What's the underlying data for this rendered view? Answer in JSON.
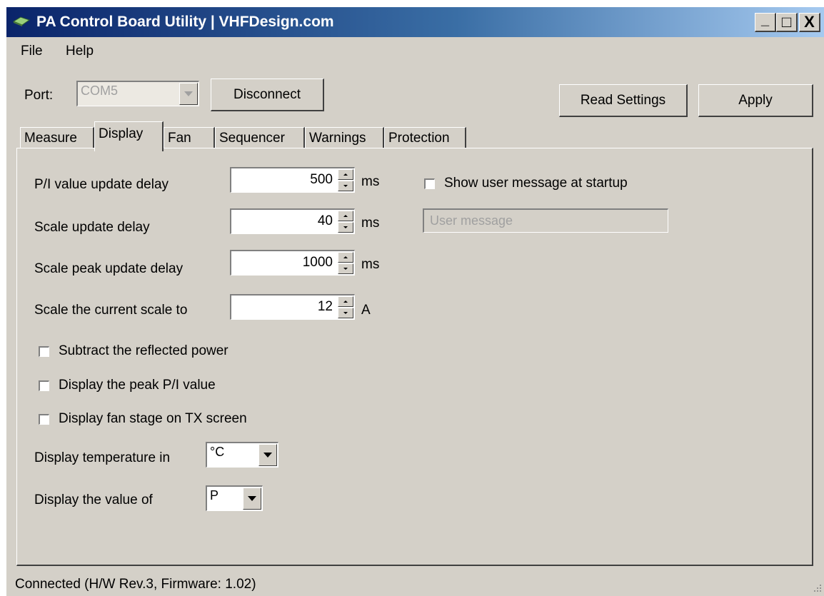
{
  "window": {
    "title": "PA Control Board Utility | VHFDesign.com",
    "minimize_label": "_",
    "maximize_label": "□",
    "close_label": "X"
  },
  "menu": [
    "File",
    "Help"
  ],
  "toolbar": {
    "port_label": "Port:",
    "port_value": "COM5",
    "disconnect_label": "Disconnect",
    "read_settings_label": "Read Settings",
    "apply_label": "Apply"
  },
  "tabs": [
    "Measure",
    "Display",
    "Fan",
    "Sequencer",
    "Warnings",
    "Protection"
  ],
  "active_tab": "Display",
  "display": {
    "rows": [
      {
        "label": "P/I value update delay",
        "value": "500",
        "unit": "ms"
      },
      {
        "label": "Scale update delay",
        "value": "40",
        "unit": "ms"
      },
      {
        "label": "Scale peak update delay",
        "value": "1000",
        "unit": "ms"
      },
      {
        "label": "Scale the current scale to",
        "value": "12",
        "unit": "A"
      }
    ],
    "checkboxes": [
      {
        "label": "Subtract the reflected power",
        "checked": false
      },
      {
        "label": "Display the peak P/I value",
        "checked": false
      },
      {
        "label": "Display fan stage on TX screen",
        "checked": false
      }
    ],
    "temperature_label": "Display temperature in",
    "temperature_value": "°C",
    "value_of_label": "Display the value of",
    "value_of_value": "P",
    "show_message_label": "Show user message at startup",
    "user_message_placeholder": "User message"
  },
  "status": {
    "text": "Connected (H/W Rev.3, Firmware: 1.02)"
  }
}
